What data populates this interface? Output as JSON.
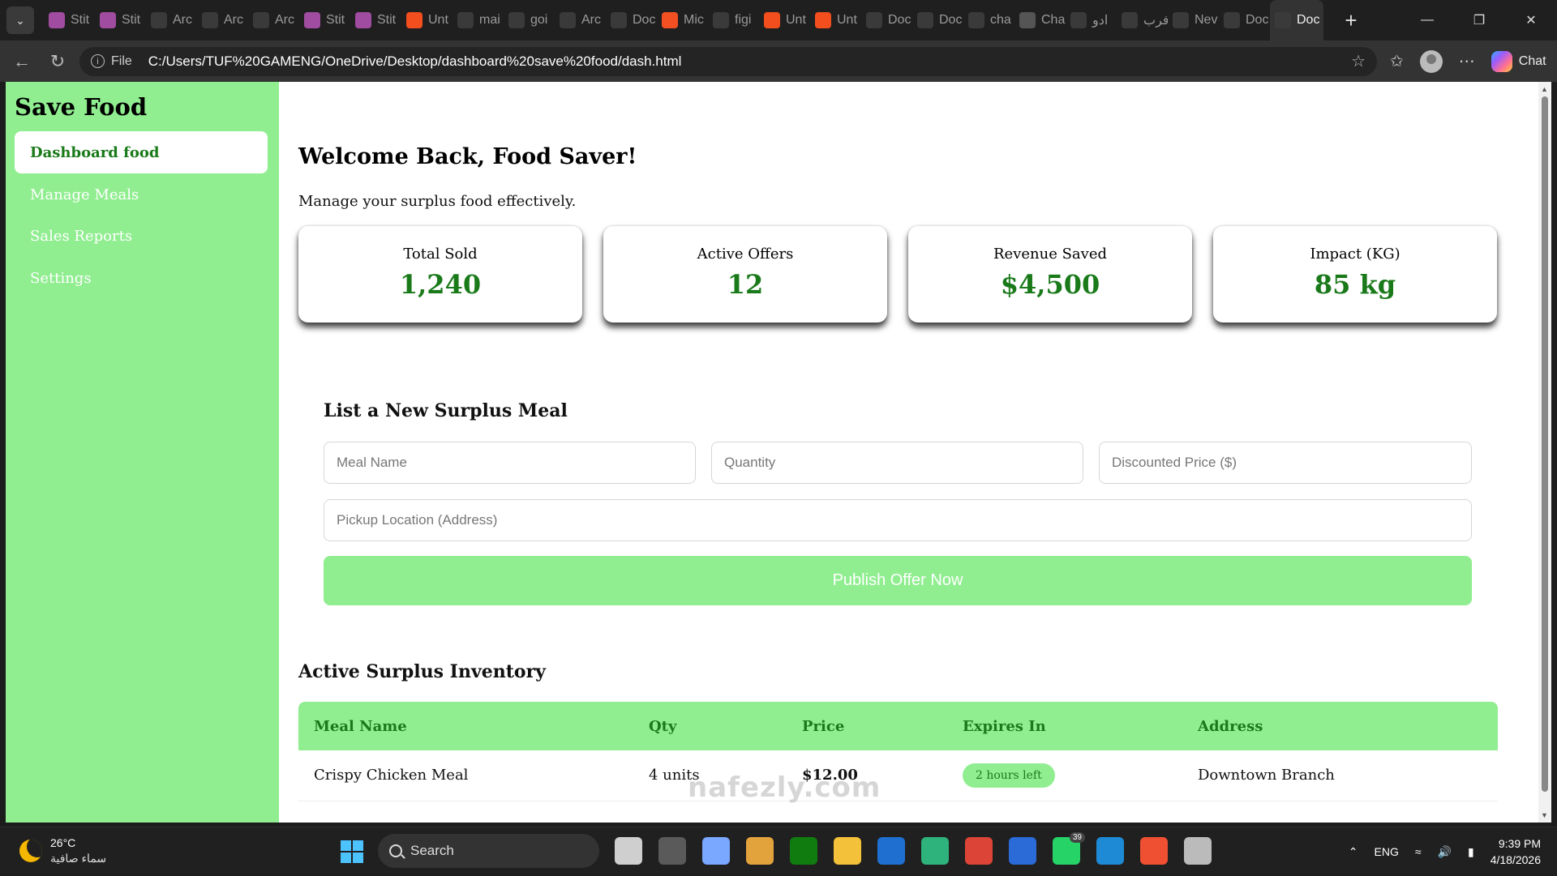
{
  "browser": {
    "tabs": [
      {
        "label": "Stit",
        "icon": "stitch-icon",
        "color": "#a04ca0"
      },
      {
        "label": "Stit",
        "icon": "stitch-icon",
        "color": "#a04ca0"
      },
      {
        "label": "Arc",
        "icon": "globe-icon",
        "color": "#3a3a3a"
      },
      {
        "label": "Arc",
        "icon": "globe-icon",
        "color": "#3a3a3a"
      },
      {
        "label": "Arc",
        "icon": "globe-icon",
        "color": "#3a3a3a"
      },
      {
        "label": "Stit",
        "icon": "stitch-icon",
        "color": "#a04ca0"
      },
      {
        "label": "Stit",
        "icon": "stitch-icon",
        "color": "#a04ca0"
      },
      {
        "label": "Unt",
        "icon": "figma-icon",
        "color": "#f24e1e"
      },
      {
        "label": "mai",
        "icon": "github-icon",
        "color": "#3a3a3a"
      },
      {
        "label": "goi",
        "icon": "github-icon",
        "color": "#3a3a3a"
      },
      {
        "label": "Arc",
        "icon": "globe-icon",
        "color": "#3a3a3a"
      },
      {
        "label": "Doc",
        "icon": "globe-icon",
        "color": "#3a3a3a"
      },
      {
        "label": "Mic",
        "icon": "microsoft-icon",
        "color": "#f25022"
      },
      {
        "label": "figi",
        "icon": "search-icon",
        "color": "#3a3a3a"
      },
      {
        "label": "Unt",
        "icon": "figma-icon",
        "color": "#f24e1e"
      },
      {
        "label": "Unt",
        "icon": "figma-icon",
        "color": "#f24e1e"
      },
      {
        "label": "Doc",
        "icon": "globe-icon",
        "color": "#3a3a3a"
      },
      {
        "label": "Doc",
        "icon": "globe-icon",
        "color": "#3a3a3a"
      },
      {
        "label": "cha",
        "icon": "search-icon",
        "color": "#3a3a3a"
      },
      {
        "label": "Cha",
        "icon": "chatgpt-icon",
        "color": "#555555"
      },
      {
        "label": "ادو",
        "icon": "search-icon",
        "color": "#3a3a3a"
      },
      {
        "label": "فرب",
        "icon": "search-icon",
        "color": "#3a3a3a"
      },
      {
        "label": "Nev",
        "icon": "newtab-icon",
        "color": "#3a3a3a"
      },
      {
        "label": "Doc",
        "icon": "globe-icon",
        "color": "#3a3a3a"
      },
      {
        "label": "Doc",
        "icon": "globe-icon",
        "color": "#3a3a3a",
        "active": true
      }
    ],
    "url_scheme": "File",
    "url": "C:/Users/TUF%20GAMENG/OneDrive/Desktop/dashboard%20save%20food/dash.html",
    "chat_label": "Chat"
  },
  "sidebar": {
    "brand": "Save Food",
    "items": [
      {
        "label": "Dashboard food",
        "active": true
      },
      {
        "label": "Manage Meals"
      },
      {
        "label": "Sales Reports"
      },
      {
        "label": "Settings"
      }
    ]
  },
  "main": {
    "welcome": "Welcome Back, Food Saver!",
    "subtitle": "Manage your surplus food effectively.",
    "stats": [
      {
        "label": "Total Sold",
        "value": "1,240"
      },
      {
        "label": "Active Offers",
        "value": "12"
      },
      {
        "label": "Revenue Saved",
        "value": "$4,500"
      },
      {
        "label": "Impact (KG)",
        "value": "85 kg"
      }
    ],
    "form": {
      "title": "List a New Surplus Meal",
      "meal_placeholder": "Meal Name",
      "quantity_placeholder": "Quantity",
      "price_placeholder": "Discounted Price ($)",
      "location_placeholder": "Pickup Location (Address)",
      "submit_label": "Publish Offer Now"
    },
    "inventory": {
      "title": "Active Surplus Inventory",
      "headers": [
        "Meal Name",
        "Qty",
        "Price",
        "Expires In",
        "Address"
      ],
      "rows": [
        {
          "meal": "Crispy Chicken Meal",
          "qty": "4 units",
          "price": "$12.00",
          "expires": "2 hours left",
          "address": "Downtown Branch"
        }
      ]
    }
  },
  "colors": {
    "accent_green": "#90ee90",
    "dark_green": "#1a7a1a"
  },
  "taskbar": {
    "temperature": "26°C",
    "weather_desc": "سماء صافية",
    "search_label": "Search",
    "apps": [
      {
        "name": "task-view-icon",
        "color": "#cfcfcf"
      },
      {
        "name": "copilot-icon",
        "color": "#5a5a5a"
      },
      {
        "name": "widgets-icon",
        "color": "#7aa7ff"
      },
      {
        "name": "store-icon",
        "color": "#e3a33c"
      },
      {
        "name": "xbox-icon",
        "color": "#107c10"
      },
      {
        "name": "file-explorer-icon",
        "color": "#f3c13a"
      },
      {
        "name": "maple-icon",
        "color": "#1f6fd1"
      },
      {
        "name": "edge-icon",
        "color": "#2fb37c"
      },
      {
        "name": "chrome-icon",
        "color": "#db4437"
      },
      {
        "name": "powershell-icon",
        "color": "#2a6bd8"
      },
      {
        "name": "whatsapp-icon",
        "color": "#25d366",
        "badge": "39"
      },
      {
        "name": "vscode-icon",
        "color": "#1e8ad6"
      },
      {
        "name": "git-icon",
        "color": "#f05032"
      },
      {
        "name": "snipping-icon",
        "color": "#bbbbbb"
      }
    ],
    "language": "ENG",
    "time": "9:39 PM",
    "date": "4/18/2026"
  },
  "watermark": "nafezly.com"
}
